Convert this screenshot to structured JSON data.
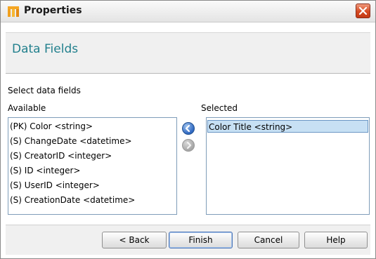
{
  "window": {
    "title": "Properties",
    "close_icon": "close-icon"
  },
  "header": {
    "title": "Data Fields"
  },
  "section": {
    "prompt": "Select data fields",
    "available_label": "Available",
    "selected_label": "Selected"
  },
  "available": {
    "items": [
      "(PK) Color <string>",
      "(S) ChangeDate <datetime>",
      "(S) CreatorID <integer>",
      "(S) ID <integer>",
      "(S) UserID <integer>",
      "(S) CreationDate <datetime>"
    ]
  },
  "selected": {
    "items": [
      "Color Title <string>"
    ],
    "selected_index": 0
  },
  "transfer": {
    "add_icon": "arrow-left-icon",
    "remove_icon": "arrow-right-icon"
  },
  "footer": {
    "back_label": "< Back",
    "finish_label": "Finish",
    "cancel_label": "Cancel",
    "help_label": "Help"
  },
  "colors": {
    "header_title": "#22808d",
    "selection_bg": "#c7e0f4",
    "selection_border": "#6b97c5",
    "close_button": "#d54a22"
  }
}
